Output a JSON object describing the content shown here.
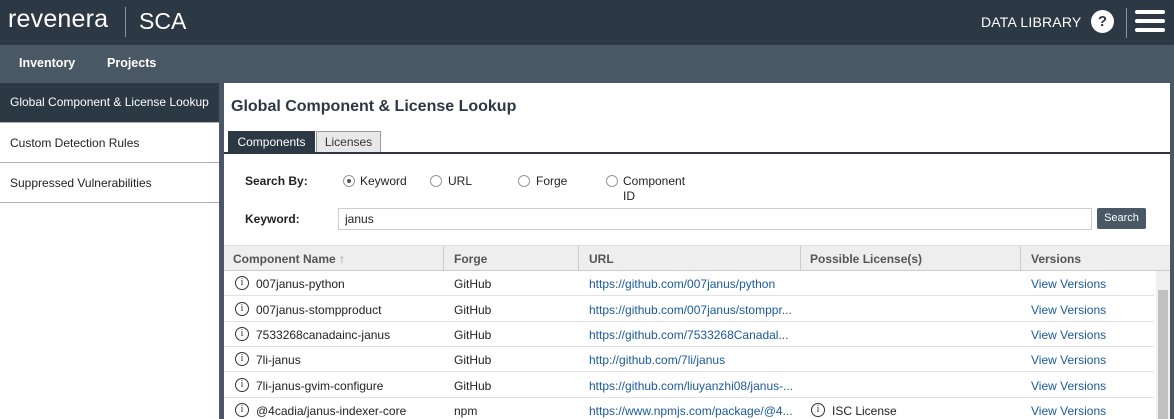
{
  "header": {
    "logo": "revenera",
    "product": "SCA",
    "data_library": "DATA LIBRARY",
    "help": "?"
  },
  "nav": {
    "items": [
      "Inventory",
      "Projects"
    ]
  },
  "sidebar": {
    "items": [
      {
        "label": "Global Component & License Lookup",
        "active": true
      },
      {
        "label": "Custom Detection Rules",
        "active": false
      },
      {
        "label": "Suppressed Vulnerabilities",
        "active": false
      }
    ]
  },
  "main": {
    "title": "Global Component & License Lookup",
    "tabs": [
      {
        "label": "Components",
        "active": true
      },
      {
        "label": "Licenses",
        "active": false
      }
    ],
    "search_by_label": "Search By:",
    "search_options": [
      {
        "label": "Keyword",
        "checked": true
      },
      {
        "label": "URL",
        "checked": false
      },
      {
        "label": "Forge",
        "checked": false
      },
      {
        "label": "Component",
        "label2": "ID",
        "checked": false
      }
    ],
    "keyword_label": "Keyword:",
    "keyword_value": "janus",
    "search_button": "Search"
  },
  "table": {
    "columns": [
      "Component Name",
      "Forge",
      "URL",
      "Possible License(s)",
      "Versions"
    ],
    "sort_indicator": "↑",
    "rows": [
      {
        "name": "007janus-python",
        "forge": "GitHub",
        "url": "https://github.com/007janus/python",
        "license": "",
        "versions": "View Versions"
      },
      {
        "name": "007janus-stompproduct",
        "forge": "GitHub",
        "url": "https://github.com/007janus/stomppr...",
        "license": "",
        "versions": "View Versions"
      },
      {
        "name": "7533268canadainc-janus",
        "forge": "GitHub",
        "url": "https://github.com/7533268Canadal...",
        "license": "",
        "versions": "View Versions"
      },
      {
        "name": "7li-janus",
        "forge": "GitHub",
        "url": "http://github.com/7li/janus",
        "license": "",
        "versions": "View Versions"
      },
      {
        "name": "7li-janus-gvim-configure",
        "forge": "GitHub",
        "url": "https://github.com/liuyanzhi08/janus-...",
        "license": "",
        "versions": "View Versions"
      },
      {
        "name": "@4cadia/janus-indexer-core",
        "forge": "npm",
        "url": "https://www.npmjs.com/package/@4...",
        "license": "ISC License",
        "versions": "View Versions"
      }
    ]
  },
  "icons": {
    "info": "i",
    "menu": "hamburger-icon",
    "help": "help-icon"
  },
  "colors": {
    "header_bg": "#2d3845",
    "nav_bg": "#4a5764",
    "link": "#1a5a9c"
  }
}
